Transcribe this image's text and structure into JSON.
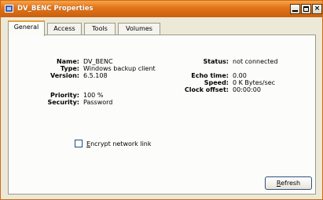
{
  "window": {
    "title": "DV_BENC Properties",
    "icon": "app-icon",
    "buttons": {
      "minimize": "minimize-icon",
      "maximize": "maximize-icon",
      "close": "×"
    }
  },
  "tabs": [
    {
      "label": "General",
      "active": true
    },
    {
      "label": "Access",
      "active": false
    },
    {
      "label": "Tools",
      "active": false
    },
    {
      "label": "Volumes",
      "active": false
    }
  ],
  "left_fields": [
    {
      "label": "Name:",
      "value": "DV_BENC"
    },
    {
      "label": "Type:",
      "value": "Windows backup client"
    },
    {
      "label": "Version:",
      "value": "6.5.108"
    },
    {
      "label": "Priority:",
      "value": "100 %"
    },
    {
      "label": "Security:",
      "value": "Password"
    }
  ],
  "right_fields": [
    {
      "label": "Status:",
      "value": "not connected"
    },
    {
      "label": "Echo time:",
      "value": "0.00"
    },
    {
      "label": "Speed:",
      "value": "0 K Bytes/sec"
    },
    {
      "label": "Clock offset:",
      "value": "00:00:00"
    }
  ],
  "encrypt_checkbox": {
    "accel": "E",
    "label_rest": "ncrypt network link",
    "checked": false
  },
  "refresh_button": {
    "accel": "R",
    "label_rest": "efresh"
  },
  "colors": {
    "title_bar": "#e2761c",
    "active_tab_accent": "#e6a13a",
    "dialog_bg": "#ece9d8"
  }
}
